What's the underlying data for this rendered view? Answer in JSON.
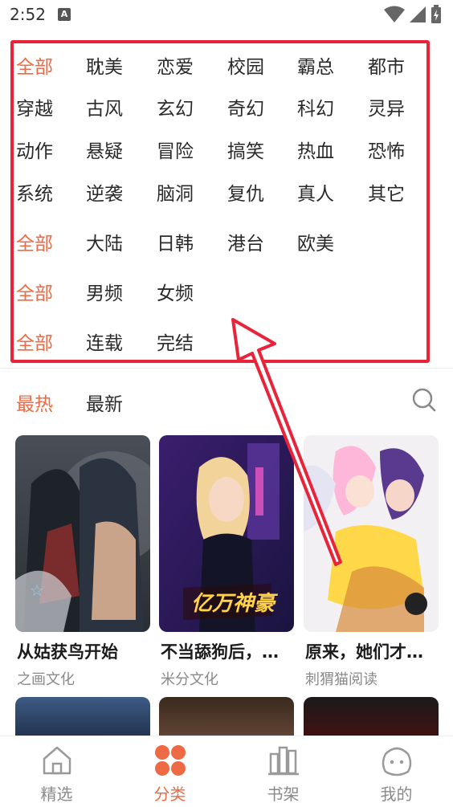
{
  "status": {
    "time": "2:52",
    "a_badge": "A"
  },
  "filters": {
    "row1": [
      "全部",
      "耽美",
      "恋爱",
      "校园",
      "霸总",
      "都市"
    ],
    "row2": [
      "穿越",
      "古风",
      "玄幻",
      "奇幻",
      "科幻",
      "灵异"
    ],
    "row3": [
      "动作",
      "悬疑",
      "冒险",
      "搞笑",
      "热血",
      "恐怖"
    ],
    "row4": [
      "系统",
      "逆袭",
      "脑洞",
      "复仇",
      "真人",
      "其它"
    ],
    "row5": [
      "全部",
      "大陆",
      "日韩",
      "港台",
      "欧美"
    ],
    "row6": [
      "全部",
      "男频",
      "女频"
    ],
    "row7": [
      "全部",
      "连载",
      "完结"
    ]
  },
  "sort": {
    "hot": "最热",
    "new": "最新"
  },
  "cards": [
    {
      "title": "从姑获鸟开始",
      "sub": "之画文化"
    },
    {
      "title": "不当舔狗后，…",
      "sub": "米分文化"
    },
    {
      "title": "原来，她们才…",
      "sub": "刺猬猫阅读"
    }
  ],
  "nav": [
    {
      "label": "精选"
    },
    {
      "label": "分类"
    },
    {
      "label": "书架"
    },
    {
      "label": "我的"
    }
  ],
  "colors": {
    "accent": "#ee6a45",
    "highlight": "#e8243a"
  }
}
